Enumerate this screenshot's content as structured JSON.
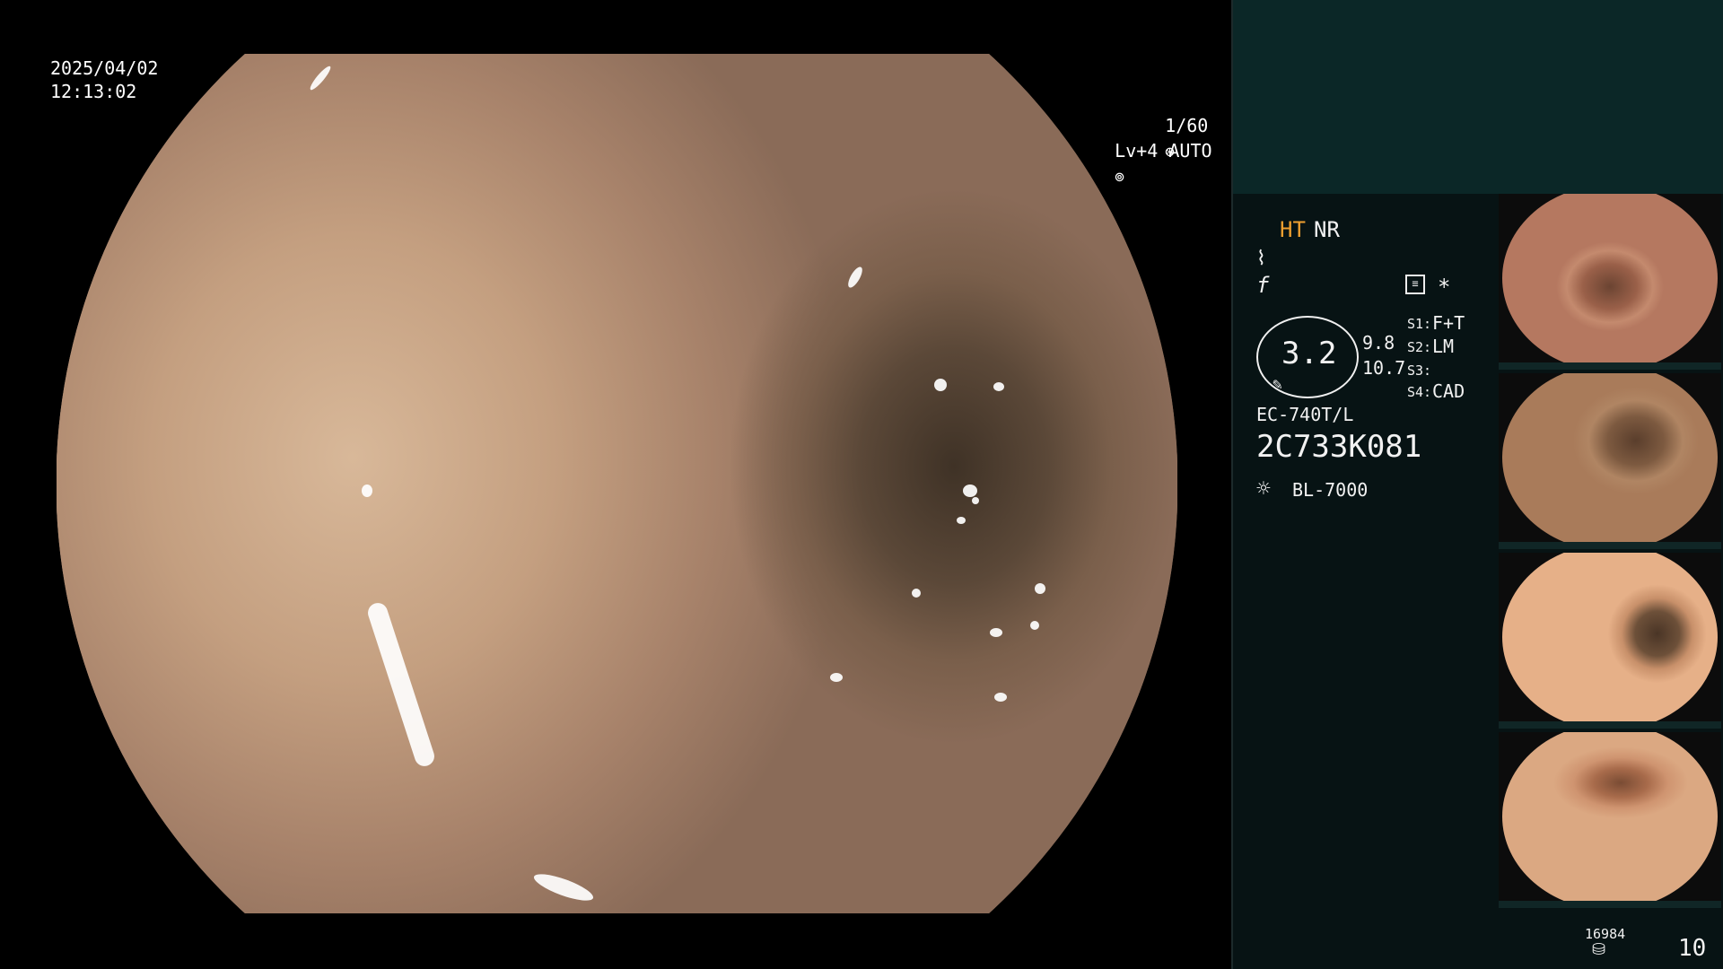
{
  "osd": {
    "date": "2025/04/02",
    "time": "12:13:02",
    "shutter": "1/60",
    "level": "Lv+4 AUTO"
  },
  "panel": {
    "mode_ht": "HT",
    "mode_nr": "NR",
    "zoom_value": "3.2",
    "zoom_sub1": "9.8",
    "zoom_sub2": "10.7",
    "settings": [
      {
        "key": "S1:",
        "value": "F+T"
      },
      {
        "key": "S2:",
        "value": "LM"
      },
      {
        "key": "S3:",
        "value": ""
      },
      {
        "key": "S4:",
        "value": "CAD"
      }
    ],
    "scope_model": "EC-740T/L",
    "scope_serial": "2C733K081",
    "light_source": "BL-7000",
    "storage_count": "16984",
    "capture_count": "10"
  },
  "colors": {
    "accent_orange": "#f0a030",
    "panel_bg": "#071314",
    "top_block": "#0b2727"
  },
  "icons": [
    "shutter-icon",
    "auto-iris-icon",
    "curve-icon",
    "function-icon",
    "menu-icon",
    "asterisk-icon",
    "pen-icon",
    "light-bulb-icon",
    "storage-icon"
  ]
}
